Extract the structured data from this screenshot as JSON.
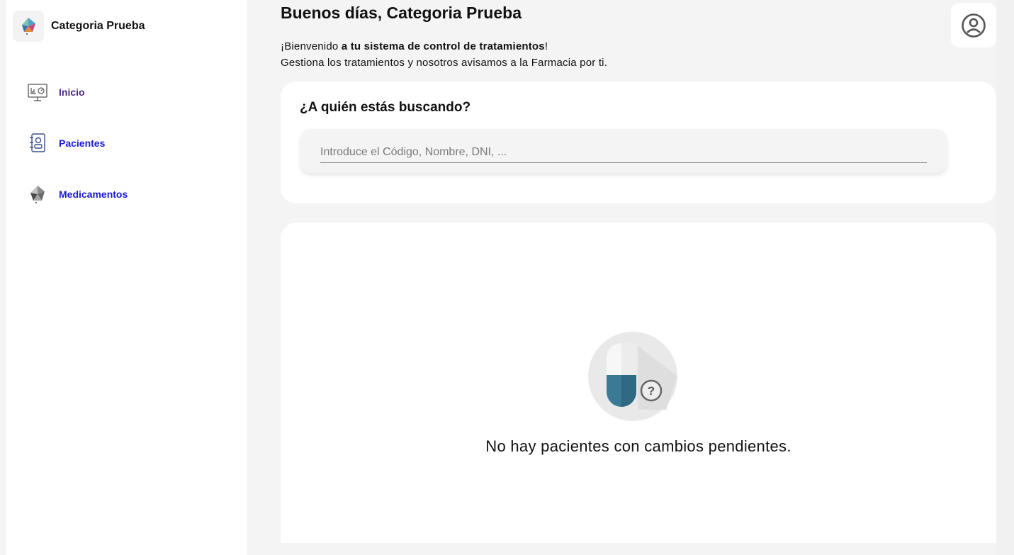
{
  "brand": {
    "name": "Categoria Prueba"
  },
  "nav": [
    {
      "label": "Inicio",
      "icon": "dashboard-monitor-icon",
      "color": "#4a2a7a"
    },
    {
      "label": "Pacientes",
      "icon": "patient-contact-icon",
      "color": "#1a1ad6"
    },
    {
      "label": "Medicamentos",
      "icon": "medicine-pills-icon",
      "color": "#1a1ad6"
    }
  ],
  "header": {
    "greeting_prefix": "Buenos días, ",
    "greeting_name": "Categoria Prueba",
    "welcome_prefix": "¡Bienvenido ",
    "welcome_bold": "a tu sistema de control de tratamientos",
    "welcome_suffix": "!",
    "welcome_line2": "Gestiona los tratamientos y nosotros avisamos a la Farmacia por ti."
  },
  "search": {
    "title": "¿A quién estás buscando?",
    "placeholder": "Introduce el Código, Nombre, DNI, ..."
  },
  "empty_state": {
    "message": "No hay pacientes con cambios pendientes.",
    "icon": "capsule-question-icon"
  },
  "user": {
    "icon": "user-account-icon"
  },
  "colors": {
    "accent_purple": "#4a2a7a",
    "accent_blue": "#1a1ad6",
    "capsule_blue": "#3a7a94"
  }
}
